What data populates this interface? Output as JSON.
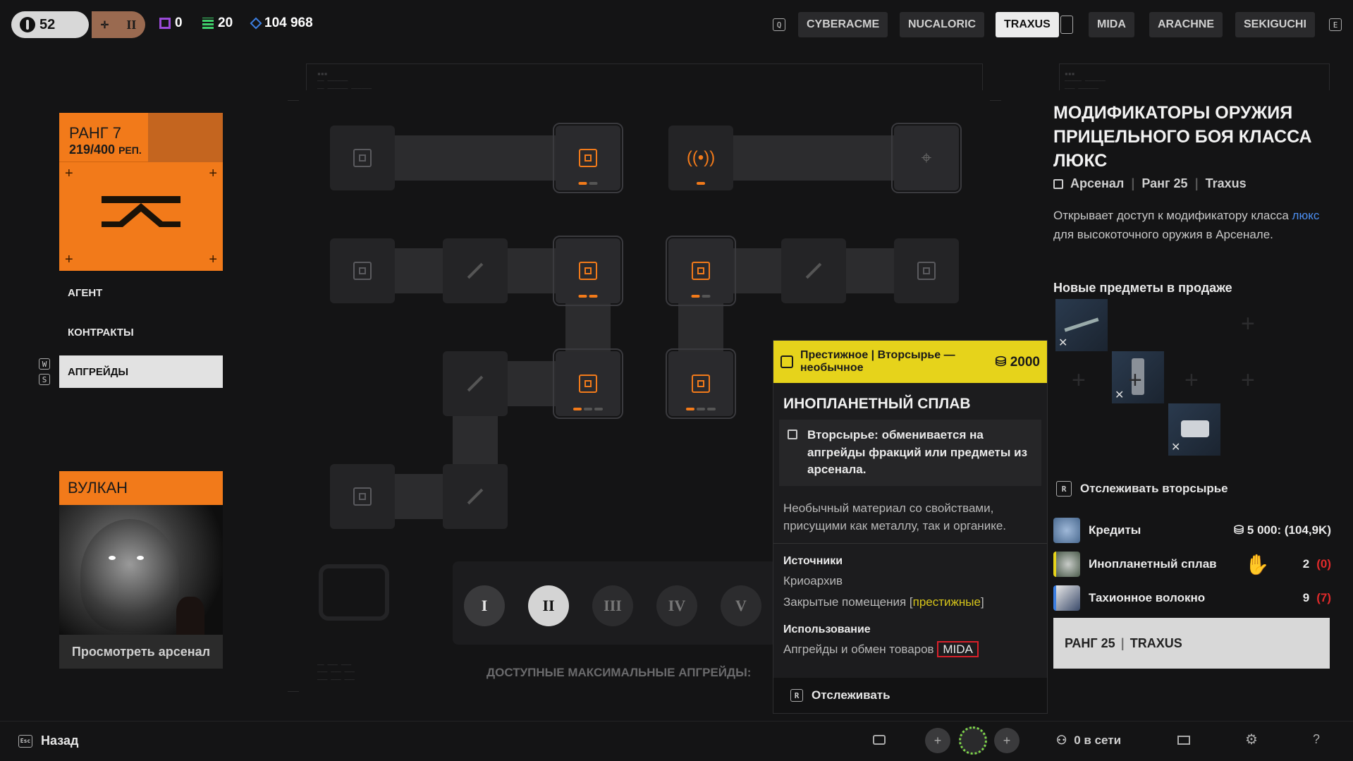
{
  "topbar": {
    "level": "52",
    "rank_roman": "II",
    "stat_purple": "0",
    "stat_green": "20",
    "credits": "104 968",
    "factions": [
      "CYBERACME",
      "NUCALORIC",
      "TRAXUS",
      "MIDA",
      "ARACHNE",
      "SEKIGUCHI"
    ],
    "active_faction": "TRAXUS",
    "key_left": "Q",
    "key_right": "E"
  },
  "rank_card": {
    "title": "РАНГ 7",
    "rep": "219/400",
    "rep_unit": "РЕП."
  },
  "menu": {
    "agent": "АГЕНТ",
    "contracts": "КОНТРАКТЫ",
    "upgrades": "АПГРЕЙДЫ",
    "key_w": "W",
    "key_s": "S"
  },
  "vulkan": {
    "title": "ВУЛКАН",
    "button": "Просмотреть арсенал"
  },
  "tree": {
    "footer": "ДОСТУПНЫЕ МАКСИМАЛЬНЫЕ АПГРЕЙДЫ:",
    "tiers": [
      "I",
      "II",
      "III",
      "IV",
      "V"
    ]
  },
  "tooltip": {
    "head_line": "Престижное | Вторсырье — необычное",
    "cost": "2000",
    "title": "ИНОПЛАНЕТНЫЙ СПЛАВ",
    "box": "Вторсырье: обменивается на апгрейды фракций или предметы из арсенала.",
    "desc": "Необычный материал со свойствами, присущими как металлу, так и органике.",
    "sources_label": "Источники",
    "source_1": "Криоархив",
    "source_2_prefix": "Закрытые помещения [",
    "source_2_tag": "престижные",
    "source_2_suffix": "]",
    "usage_label": "Использование",
    "usage_prefix": "Апгрейды и обмен товаров",
    "usage_tag": "MIDA",
    "track_key": "R",
    "track": "Отслеживать"
  },
  "right_panel": {
    "title": "МОДИФИКАТОРЫ ОРУЖИЯ ПРИЦЕЛЬНОГО БОЯ КЛАССА ЛЮКС",
    "meta_section": "Арсенал",
    "meta_rank": "Ранг 25",
    "meta_faction": "Traxus",
    "desc_prefix": "Открывает доступ к модификатору класса",
    "desc_link": "люкс",
    "desc_suffix": "для высокоточного оружия в Арсенале.",
    "new_items": "Новые предметы в продаже",
    "track_recycle_key": "R",
    "track_recycle": "Отслеживать вторсырье",
    "resources": [
      {
        "name": "Кредиты",
        "value": "5 000: (104,9K)",
        "missing": ""
      },
      {
        "name": "Инопланетный сплав",
        "value": "2",
        "missing": "(0)"
      },
      {
        "name": "Тахионное волокно",
        "value": "9",
        "missing": "(7)"
      }
    ],
    "rank_button_rank": "РАНГ 25",
    "rank_button_faction": "TRAXUS"
  },
  "bottom": {
    "back_key": "Esc",
    "back": "Назад",
    "online": "0 в сети"
  },
  "colors": {
    "accent": "#f27a1a",
    "tooltip_head": "#e6d31b",
    "missing": "#e02a2a",
    "link": "#4c8ef0",
    "highlight_box": "#d8202a"
  }
}
